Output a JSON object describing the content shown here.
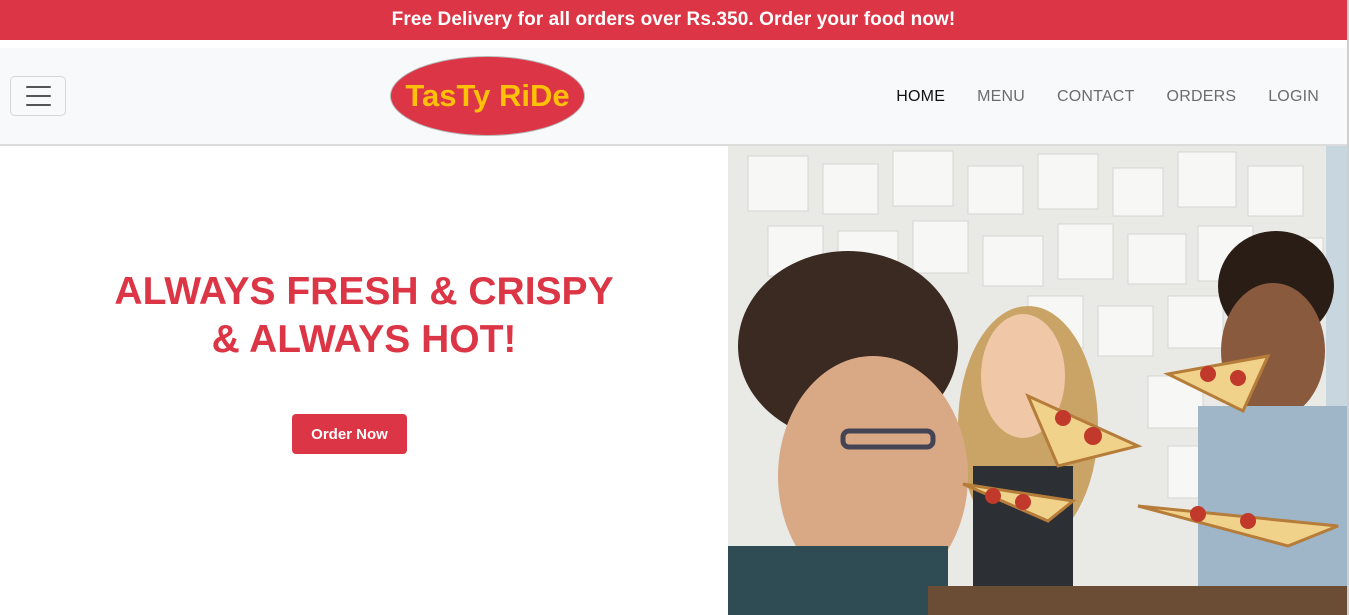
{
  "promo": {
    "text": "Free Delivery for all orders over Rs.350. Order your food now!"
  },
  "navbar": {
    "brand": "TasTy RiDe",
    "links": [
      {
        "label": "HOME",
        "active": true
      },
      {
        "label": "MENU",
        "active": false
      },
      {
        "label": "CONTACT",
        "active": false
      },
      {
        "label": "ORDERS",
        "active": false
      },
      {
        "label": "LOGIN",
        "active": false
      }
    ]
  },
  "hero": {
    "title_line1": "ALWAYS FRESH & CRISPY",
    "title_line2": "& ALWAYS HOT!",
    "cta_label": "Order Now",
    "image_icon": "friends-eating-pizza-photo"
  },
  "colors": {
    "brand_red": "#dc3545",
    "brand_yellow": "#ffc107",
    "navbar_bg": "#f8f9fa"
  }
}
